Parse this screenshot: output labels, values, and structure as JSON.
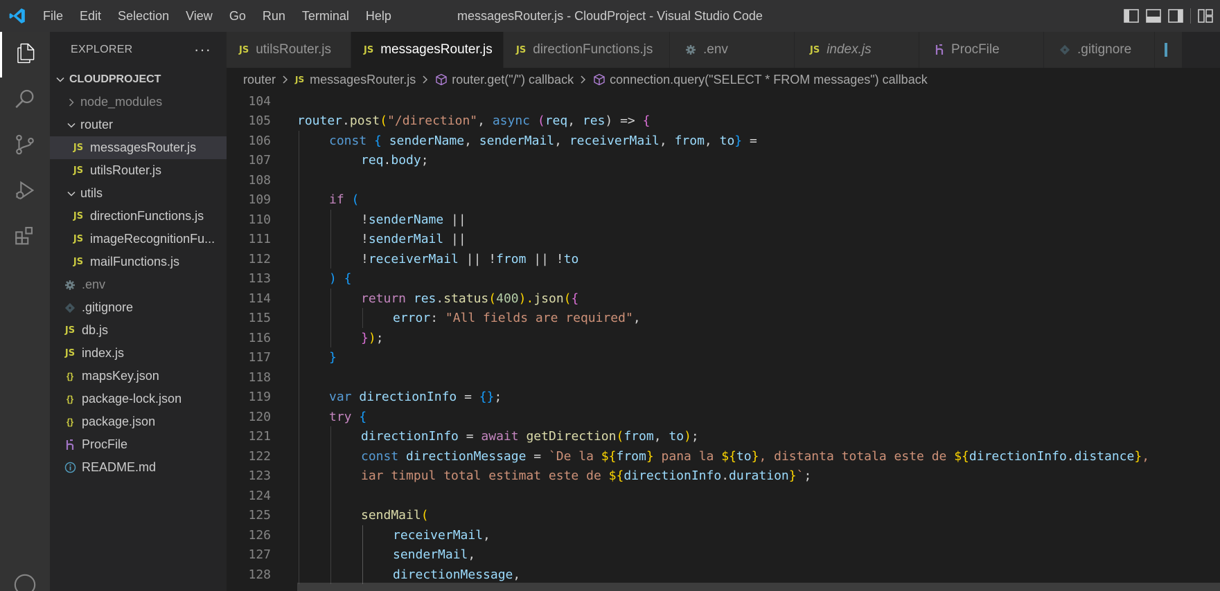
{
  "window": {
    "title": "messagesRouter.js - CloudProject - Visual Studio Code",
    "menu": [
      "File",
      "Edit",
      "Selection",
      "View",
      "Go",
      "Run",
      "Terminal",
      "Help"
    ]
  },
  "explorer": {
    "header": "EXPLORER",
    "more": "···",
    "project": "CLOUDPROJECT",
    "items": [
      {
        "label": "node_modules",
        "kind": "folder-collapsed",
        "dim": true
      },
      {
        "label": "router",
        "kind": "folder-open"
      },
      {
        "label": "messagesRouter.js",
        "kind": "js",
        "selected": true
      },
      {
        "label": "utilsRouter.js",
        "kind": "js"
      },
      {
        "label": "utils",
        "kind": "folder-open"
      },
      {
        "label": "directionFunctions.js",
        "kind": "js"
      },
      {
        "label": "imageRecognitionFu...",
        "kind": "js"
      },
      {
        "label": "mailFunctions.js",
        "kind": "js"
      },
      {
        "label": ".env",
        "kind": "env",
        "dim": true
      },
      {
        "label": ".gitignore",
        "kind": "git"
      },
      {
        "label": "db.js",
        "kind": "js"
      },
      {
        "label": "index.js",
        "kind": "js"
      },
      {
        "label": "mapsKey.json",
        "kind": "json"
      },
      {
        "label": "package-lock.json",
        "kind": "json"
      },
      {
        "label": "package.json",
        "kind": "json"
      },
      {
        "label": "ProcFile",
        "kind": "procfile"
      },
      {
        "label": "README.md",
        "kind": "info"
      }
    ]
  },
  "tabs": [
    {
      "label": "utilsRouter.js",
      "icon": "JS"
    },
    {
      "label": "messagesRouter.js",
      "icon": "JS",
      "active": true
    },
    {
      "label": "directionFunctions.js",
      "icon": "JS"
    },
    {
      "label": ".env",
      "icon": "gear"
    },
    {
      "label": "index.js",
      "icon": "JS",
      "italic": true
    },
    {
      "label": "ProcFile",
      "icon": "procfile"
    },
    {
      "label": ".gitignore",
      "icon": "git"
    }
  ],
  "breadcrumb": {
    "folder": "router",
    "file": "messagesRouter.js",
    "fn1": "router.get(\"/\") callback",
    "fn2": "connection.query(\"SELECT * FROM messages\") callback"
  },
  "editor": {
    "line_numbers": [
      "104",
      "105",
      "106",
      "107",
      "108",
      "109",
      "110",
      "111",
      "112",
      "113",
      "114",
      "115",
      "116",
      "117",
      "118",
      "119",
      "120",
      "121",
      "122",
      "123",
      "124",
      "125",
      "126",
      "127",
      "128"
    ],
    "lines": {
      "l105": {
        "a": "router",
        "b": ".",
        "c": "post",
        "d": "(",
        "e": "\"/direction\"",
        "f": ", ",
        "g": "async",
        "h": " (",
        "i": "req",
        "j": ", ",
        "k": "res",
        "l": ") => ",
        "m": "{"
      },
      "l106": {
        "a": "const",
        "b": " { ",
        "c": "senderName",
        "d": ", ",
        "e": "senderMail",
        "f": ", ",
        "g": "receiverMail",
        "h": ", ",
        "i": "from",
        "j": ", ",
        "k": "to",
        "l": "}",
        "m": " ="
      },
      "l107": {
        "a": "req",
        "b": ".",
        "c": "body",
        "d": ";"
      },
      "l109": {
        "a": "if",
        "b": " ("
      },
      "l110": {
        "a": "!",
        "b": "senderName",
        "c": " ||"
      },
      "l111": {
        "a": "!",
        "b": "senderMail",
        "c": " ||"
      },
      "l112": {
        "a": "!",
        "b": "receiverMail",
        "c": " || !",
        "d": "from",
        "e": " || !",
        "f": "to"
      },
      "l113": {
        "a": ")",
        "b": " {"
      },
      "l114": {
        "a": "return",
        "b": " ",
        "c": "res",
        "d": ".",
        "e": "status",
        "f": "(",
        "g": "400",
        "h": ").",
        "i": "json",
        "j": "(",
        "k": "{"
      },
      "l115": {
        "a": "error",
        "b": ": ",
        "c": "\"All fields are required\"",
        "d": ","
      },
      "l116": {
        "a": "}",
        "b": ")",
        "c": ";"
      },
      "l117": {
        "a": "}"
      },
      "l119": {
        "a": "var",
        "b": " ",
        "c": "directionInfo",
        "d": " = ",
        "e": "{}",
        "f": ";"
      },
      "l120": {
        "a": "try",
        "b": " {"
      },
      "l121": {
        "a": "directionInfo",
        "b": " = ",
        "c": "await",
        "d": " ",
        "e": "getDirection",
        "f": "(",
        "g": "from",
        "h": ", ",
        "i": "to",
        "j": ")",
        "k": ";"
      },
      "l122": {
        "a": "const",
        "b": " ",
        "c": "directionMessage",
        "d": " = ",
        "e": "`De la ",
        "f": "${",
        "g": "from",
        "h": "}",
        "i": " pana la ",
        "j": "${",
        "k": "to",
        "l": "}",
        "m": ", distanta totala este de ",
        "n": "${",
        "o": "directionInfo",
        "p": ".",
        "q": "distance",
        "r": "}",
        "s": ","
      },
      "l123": {
        "a": "iar timpul total estimat este de ",
        "b": "${",
        "c": "directionInfo",
        "d": ".",
        "e": "duration",
        "f": "}",
        "g": "`",
        "h": ";"
      },
      "l125": {
        "a": "sendMail",
        "b": "("
      },
      "l126": {
        "a": "receiverMail",
        "b": ","
      },
      "l127": {
        "a": "senderMail",
        "b": ","
      },
      "l128": {
        "a": "directionMessage",
        "b": ","
      }
    }
  },
  "colors": {
    "keyword": "#c586c0",
    "storage": "#569cd6",
    "function": "#dcdcaa",
    "variable": "#9cdcfe",
    "string": "#ce9178",
    "number": "#b5cea8",
    "js_icon": "#cbcb41",
    "vscode_blue": "#23a9f2"
  }
}
